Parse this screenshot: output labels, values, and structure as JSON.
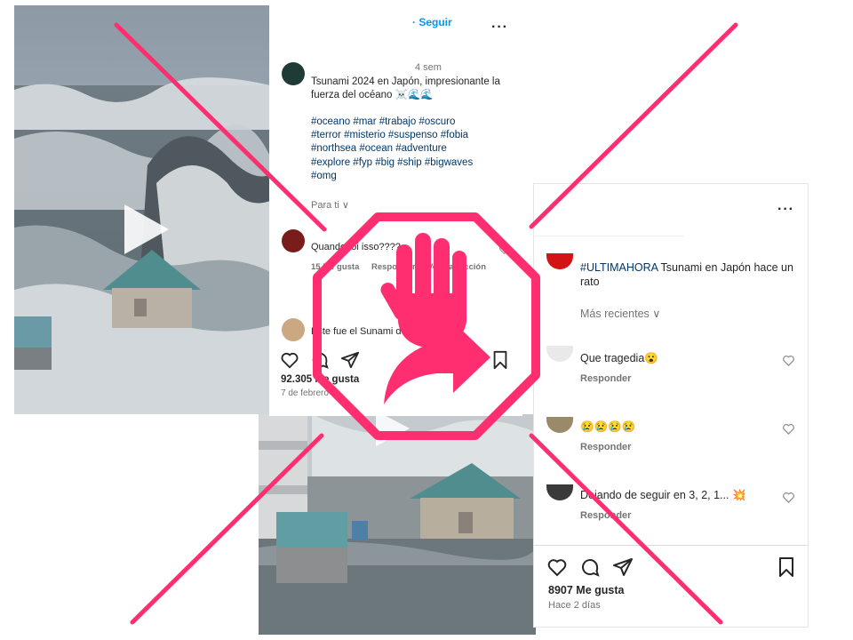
{
  "post1": {
    "follow_label": "· Seguir",
    "more_label": "···",
    "time_ago": "4 sem",
    "caption": "Tsunami 2024 en Japón, impresionante la fuerza del océano ☠️🌊🌊",
    "hashtags": [
      "#oceano #mar #trabajo #oscuro",
      "#terror #misterio #suspenso #fobia",
      "#northsea #ocean #adventure",
      "#explore #fyp #big #ship #bigwaves",
      "#omg"
    ],
    "para_ti": "Para ti ∨",
    "comment1": {
      "text": "Quando foi isso????",
      "likes": "15 Me gusta",
      "reply": "Responder",
      "translation": "Ver traducción"
    },
    "comment2": {
      "text": "Este fue el Sunami de Japón en el"
    },
    "likes": "92.305 Me gusta",
    "date": "7 de febrero"
  },
  "post2": {
    "more_label": "···",
    "caption_hashtag": "#ULTIMAHORA",
    "caption_rest": " Tsunami en Japón hace un rato",
    "sort_label": "Más recientes ∨",
    "comments": [
      {
        "text": "Que tragedia😮",
        "reply": "Responder"
      },
      {
        "text": "😢😢😢😢",
        "reply": "Responder"
      },
      {
        "text": "Dejando de seguir en 3, 2, 1... 💥",
        "reply": "Responder"
      }
    ],
    "likes": "8907 Me gusta",
    "date": "Hace 2 días"
  },
  "colors": {
    "overlay_pink": "#ff2e70",
    "link_blue": "#0095f6",
    "hashtag_blue": "#00376b"
  },
  "icons": [
    "play-icon",
    "heart-icon",
    "comment-icon",
    "share-icon",
    "bookmark-icon",
    "stop-hand-icon",
    "share-arrow-icon"
  ]
}
